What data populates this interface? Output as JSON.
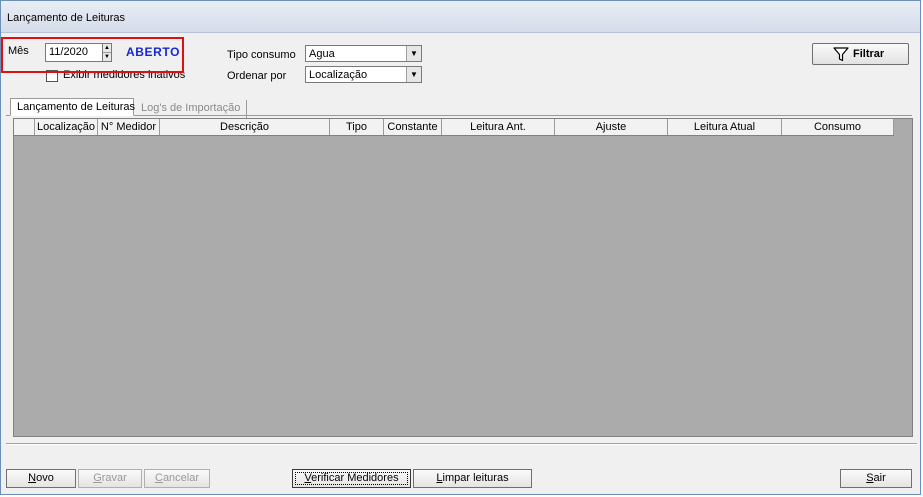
{
  "window": {
    "title": "Lançamento de Leituras"
  },
  "filters": {
    "mes_label": "Mês",
    "mes_value": "11/2020",
    "status": "ABERTO",
    "inactive_label": "Exibir medidores inativos",
    "tipo_label": "Tipo consumo",
    "tipo_value": "Agua",
    "ordenar_label": "Ordenar por",
    "ordenar_value": "Localização",
    "filter_button": "Filtrar"
  },
  "tabs": [
    {
      "label": "Lançamento de Leituras",
      "active": true
    },
    {
      "label": "Log's de Importação",
      "active": false
    }
  ],
  "grid": {
    "columns": [
      "Localização",
      "N° Medidor",
      "Descrição",
      "Tipo",
      "Constante",
      "Leitura Ant.",
      "Ajuste",
      "Leitura Atual",
      "Consumo"
    ],
    "rows": []
  },
  "buttons": {
    "novo": {
      "first": "N",
      "rest": "ovo"
    },
    "gravar": {
      "first": "G",
      "rest": "ravar"
    },
    "cancelar": {
      "first": "C",
      "rest": "ancelar"
    },
    "verificar": {
      "first": "V",
      "rest": "erificar Medidores"
    },
    "limpar": {
      "first": "L",
      "rest": "impar leituras"
    },
    "sair": {
      "first": "S",
      "rest": "air"
    }
  },
  "colors": {
    "status": "#1a26d0",
    "highlight": "#e01010",
    "grid_bg": "#ababab"
  }
}
